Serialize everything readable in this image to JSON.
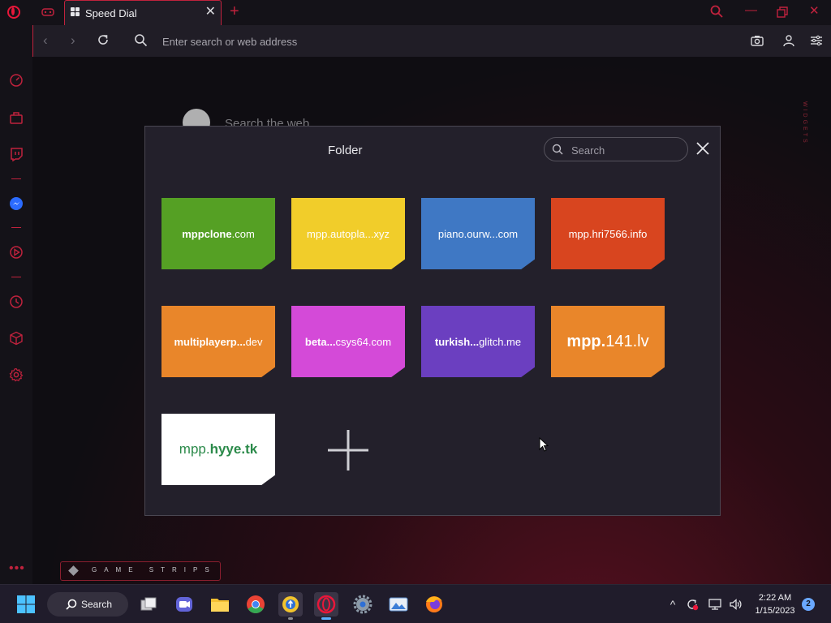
{
  "tabs": [
    {
      "title": "Speed Dial",
      "active": true
    }
  ],
  "address_bar": {
    "placeholder": "Enter search or web address"
  },
  "background": {
    "search_text": "Search the web",
    "widgets_label": "WIDGETS",
    "game_strips_label": "GAME STRIPS"
  },
  "folder": {
    "title": "Folder",
    "search_placeholder": "Search",
    "tiles": [
      {
        "label_pre": "mppclone",
        "label_post": ".com",
        "color": "#55a024"
      },
      {
        "label_pre": "mpp.autopla...",
        "label_post": "xyz",
        "color": "#f1cd2a"
      },
      {
        "label_pre": "piano.ourw...",
        "label_post": "com",
        "color": "#3f78c4"
      },
      {
        "label_pre": "mpp.hri7566.",
        "label_post": "info",
        "color": "#d8451f"
      },
      {
        "label_pre": "multiplayerp...",
        "label_post": "dev",
        "color": "#e9862a"
      },
      {
        "label_pre": "beta...",
        "label_post": "csys64.com",
        "color": "#d44ad8"
      },
      {
        "label_pre": "turkish...",
        "label_post": "glitch.me",
        "color": "#6b3fc0"
      },
      {
        "label_pre": "mpp.",
        "label_post": "141.lv",
        "color": "#e9862a"
      },
      {
        "label_pre": "mpp.",
        "label_post": "hyye.tk",
        "color": "#ffffff"
      }
    ]
  },
  "taskbar": {
    "search_label": "Search",
    "time": "2:22 AM",
    "date": "1/15/2023",
    "notification_count": "2"
  },
  "colors": {
    "accent": "#c0223d",
    "modal_bg": "#23202b"
  }
}
